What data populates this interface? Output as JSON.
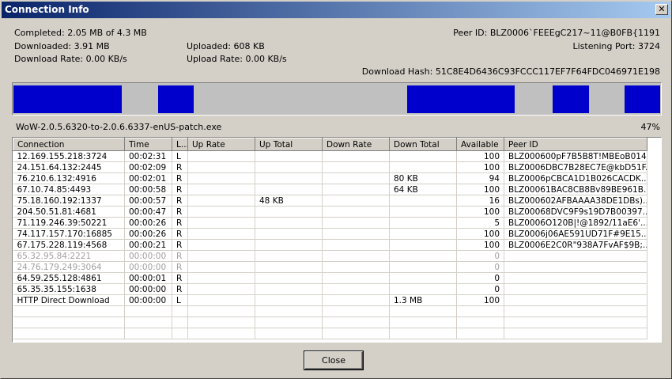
{
  "window": {
    "title": "Connection Info",
    "close_glyph": "✕"
  },
  "stats": {
    "completed": "Completed: 2.05 MB of 4.3 MB",
    "downloaded": "Downloaded: 3.91 MB",
    "download_rate": "Download Rate: 0.00 KB/s",
    "uploaded": "Uploaded: 608 KB",
    "upload_rate": "Upload Rate: 0.00 KB/s",
    "peer_id": "Peer ID: BLZ0006`FEEEgC217~11@B0FB{1191",
    "listening_port": "Listening Port: 3724",
    "download_hash": "Download Hash: 51C8E4D6436C93FCCC117EF7F64FDC046971E198"
  },
  "progress": {
    "color": "#0000cc",
    "segments": [
      {
        "start": 0.0,
        "end": 0.168
      },
      {
        "start": 0.224,
        "end": 0.279
      },
      {
        "start": 0.609,
        "end": 0.775
      },
      {
        "start": 0.834,
        "end": 0.89
      },
      {
        "start": 0.945,
        "end": 1.0
      }
    ]
  },
  "file": {
    "name": "WoW-2.0.5.6320-to-2.0.6.6337-enUS-patch.exe",
    "percent": "47%"
  },
  "table": {
    "columns": [
      "Connection",
      "Time",
      "L...",
      "Up Rate",
      "Up Total",
      "Down Rate",
      "Down Total",
      "Available",
      "Peer ID"
    ],
    "rows": [
      {
        "dim": false,
        "cells": [
          "12.169.155.218:3724",
          "00:02:31",
          "L",
          "",
          "",
          "",
          "",
          "100",
          "BLZ000600pF7B5B8T!MBEoB014..."
        ]
      },
      {
        "dim": false,
        "cells": [
          "24.151.64.132:2445",
          "00:02:09",
          "R",
          "",
          "",
          "",
          "",
          "100",
          "BLZ0006DBC7B28EC7E@kbD51F..."
        ]
      },
      {
        "dim": false,
        "cells": [
          "76.210.6.132:4916",
          "00:02:01",
          "R",
          "",
          "",
          "",
          "80 KB",
          "94",
          "BLZ0006pCBCA1D1B026CACDK..."
        ]
      },
      {
        "dim": false,
        "cells": [
          "67.10.74.85:4493",
          "00:00:58",
          "R",
          "",
          "",
          "",
          "64 KB",
          "100",
          "BLZ00061BAC8CB8Bv89BE961B..."
        ]
      },
      {
        "dim": false,
        "cells": [
          "75.18.160.192:1337",
          "00:00:57",
          "R",
          "",
          "48 KB",
          "",
          "",
          "16",
          "BLZ000602AFBAAAA38DE1DBs)..."
        ]
      },
      {
        "dim": false,
        "cells": [
          "204.50.51.81:4681",
          "00:00:47",
          "R",
          "",
          "",
          "",
          "",
          "100",
          "BLZ00068DVC9F9s19D7B00397..."
        ]
      },
      {
        "dim": false,
        "cells": [
          "71.119.246.39:50221",
          "00:00:26",
          "R",
          "",
          "",
          "",
          "",
          "5",
          "BLZ0006O120B|!@1892/11aE6'..."
        ]
      },
      {
        "dim": false,
        "cells": [
          "74.117.157.170:16885",
          "00:00:26",
          "R",
          "",
          "",
          "",
          "",
          "100",
          "BLZ0006j06AE591UD71F#9E15..."
        ]
      },
      {
        "dim": false,
        "cells": [
          "67.175.228.119:4568",
          "00:00:21",
          "R",
          "",
          "",
          "",
          "",
          "100",
          "BLZ0006E2C0R\"938A7FvAF$9B;..."
        ]
      },
      {
        "dim": true,
        "cells": [
          "65.32.95.84:2221",
          "00:00:00",
          "R",
          "",
          "",
          "",
          "",
          "0",
          ""
        ]
      },
      {
        "dim": true,
        "cells": [
          "24.76.179.249:3064",
          "00:00:00",
          "R",
          "",
          "",
          "",
          "",
          "0",
          ""
        ]
      },
      {
        "dim": false,
        "cells": [
          "64.59.255.128:4861",
          "00:00:01",
          "R",
          "",
          "",
          "",
          "",
          "0",
          ""
        ]
      },
      {
        "dim": false,
        "cells": [
          "65.35.35.155:1638",
          "00:00:00",
          "R",
          "",
          "",
          "",
          "",
          "0",
          ""
        ]
      },
      {
        "dim": false,
        "cells": [
          "HTTP Direct Download",
          "00:00:00",
          "L",
          "",
          "",
          "",
          "1.3 MB",
          "100",
          ""
        ]
      }
    ],
    "empty_rows": 3
  },
  "buttons": {
    "close_label": "Close"
  }
}
